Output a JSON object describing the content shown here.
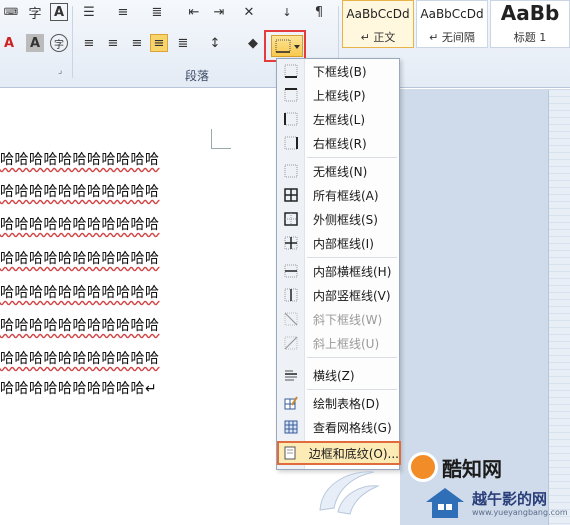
{
  "ribbon": {
    "group_label": "段落",
    "styles": [
      {
        "sample": "AaBbCcDd",
        "name": "↵ 正文"
      },
      {
        "sample": "AaBbCcDd",
        "name": "↵ 无间隔"
      },
      {
        "sample": "AaBb",
        "name": "标题 1"
      }
    ]
  },
  "document": {
    "lines": [
      "哈哈哈哈哈哈哈哈哈哈哈",
      "哈哈哈哈哈哈哈哈哈哈哈",
      "哈哈哈哈哈哈哈哈哈哈哈",
      "哈哈哈哈哈哈哈哈哈哈哈",
      "哈哈哈哈哈哈哈哈哈哈哈",
      "哈哈哈哈哈哈哈哈哈哈哈",
      "哈哈哈哈哈哈哈哈哈哈哈",
      "哈哈哈哈哈哈哈哈哈哈↵"
    ]
  },
  "menu": {
    "items": [
      {
        "label": "下框线(B)",
        "icon": "bottom-border-icon"
      },
      {
        "label": "上框线(P)",
        "icon": "top-border-icon"
      },
      {
        "label": "左框线(L)",
        "icon": "left-border-icon"
      },
      {
        "label": "右框线(R)",
        "icon": "right-border-icon"
      },
      {
        "label": "无框线(N)",
        "icon": "no-border-icon"
      },
      {
        "label": "所有框线(A)",
        "icon": "all-borders-icon"
      },
      {
        "label": "外侧框线(S)",
        "icon": "outside-borders-icon"
      },
      {
        "label": "内部框线(I)",
        "icon": "inside-borders-icon"
      },
      {
        "label": "内部横框线(H)",
        "icon": "inside-horizontal-border-icon"
      },
      {
        "label": "内部竖框线(V)",
        "icon": "inside-vertical-border-icon"
      },
      {
        "label": "斜下框线(W)",
        "icon": "diagonal-down-border-icon"
      },
      {
        "label": "斜上框线(U)",
        "icon": "diagonal-up-border-icon"
      },
      {
        "label": "横线(Z)",
        "icon": "horizontal-line-icon"
      },
      {
        "label": "绘制表格(D)",
        "icon": "draw-table-icon"
      },
      {
        "label": "查看网格线(G)",
        "icon": "view-gridlines-icon"
      },
      {
        "label": "边框和底纹(O)...",
        "icon": "borders-shading-icon"
      }
    ]
  },
  "watermark": {
    "brand": "酷知网",
    "site_name": "越午影的网",
    "site_url": "www.yueyangbang.com"
  },
  "colors": {
    "highlight_border": "#e43c3c",
    "ribbon_bg": "#e4ebf5",
    "menu_hover": "#fdebb6"
  }
}
